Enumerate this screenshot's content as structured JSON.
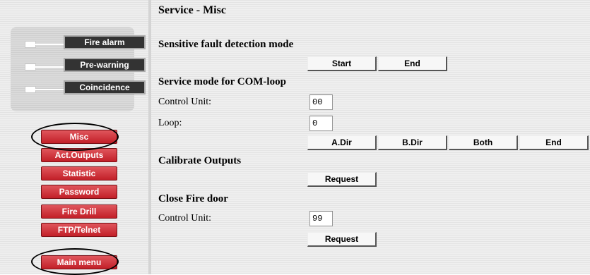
{
  "status": {
    "fire_alarm": "Fire alarm",
    "pre_warning": "Pre-warning",
    "coincidence": "Coincidence"
  },
  "menu": {
    "misc": "Misc",
    "act_outputs": "Act.Outputs",
    "statistic": "Statistic",
    "password": "Password",
    "fire_drill": "Fire Drill",
    "ftp_telnet": "FTP/Telnet",
    "main_menu": "Main menu"
  },
  "page": {
    "title": "Service - Misc"
  },
  "fault_detection": {
    "heading": "Sensitive fault detection mode",
    "start_label": "Start",
    "end_label": "End"
  },
  "com_loop": {
    "heading": "Service mode for COM-loop",
    "control_unit_label": "Control Unit:",
    "control_unit_value": "00",
    "loop_label": "Loop:",
    "loop_value": "0",
    "adir_label": "A.Dir",
    "bdir_label": "B.Dir",
    "both_label": "Both",
    "end_label": "End"
  },
  "calibrate": {
    "heading": "Calibrate Outputs",
    "request_label": "Request"
  },
  "fire_door": {
    "heading": "Close Fire door",
    "control_unit_label": "Control Unit:",
    "control_unit_value": "99",
    "request_label": "Request"
  }
}
